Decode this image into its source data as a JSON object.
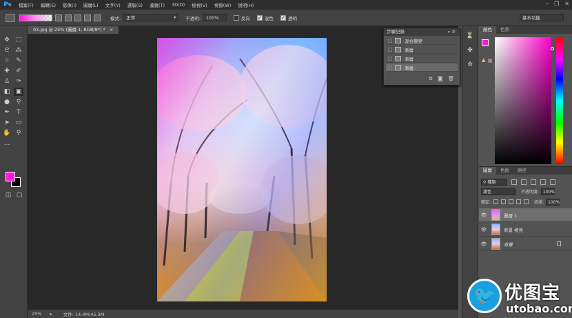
{
  "app": {
    "logo": "Ps"
  },
  "menu": [
    "檔案(F)",
    "編輯(E)",
    "影像(I)",
    "圖層(L)",
    "文字(Y)",
    "選取(S)",
    "濾鏡(T)",
    "3D(D)",
    "檢視(V)",
    "視窗(W)",
    "說明(H)"
  ],
  "window_controls": [
    "–",
    "❐",
    "✕"
  ],
  "options": {
    "mode_label": "模式:",
    "mode_value": "正常",
    "opacity_label": "不透明:",
    "opacity_value": "100%",
    "reverse_label": "反向",
    "reverse_checked": false,
    "dither_label": "混色",
    "dither_checked": true,
    "transparency_label": "透明",
    "transparency_checked": true,
    "workspace": "基本功能"
  },
  "document": {
    "tab_title": "02.jpg @ 25% (圖層 1, RGB/8*) *",
    "tab_close": "×"
  },
  "status": {
    "zoom": "25%",
    "file_info": "文件: 14.4M/45.3M"
  },
  "history": {
    "title": "步驟記錄",
    "items": [
      {
        "label": "混合變更",
        "selected": false
      },
      {
        "label": "漸層",
        "selected": false
      },
      {
        "label": "漸層",
        "selected": false
      },
      {
        "label": "漸層",
        "selected": true
      }
    ]
  },
  "color_panel": {
    "tabs": [
      "顏色",
      "色票"
    ],
    "foreground": "#ff1ad9",
    "hue_color": "#ff00cc"
  },
  "layers_panel": {
    "tabs": [
      "圖層",
      "色版",
      "路徑"
    ],
    "kind_label": "種類",
    "blend_mode": "濾色",
    "opacity_label": "不透明度:",
    "opacity_value": "100%",
    "lock_label": "鎖定:",
    "fill_label": "填滿:",
    "fill_value": "100%",
    "layers": [
      {
        "name": "圖層 1",
        "selected": true,
        "locked": false
      },
      {
        "name": "背景 拷貝",
        "selected": false,
        "locked": false
      },
      {
        "name": "背景",
        "selected": false,
        "locked": true
      }
    ]
  },
  "watermark": {
    "cn": "优图宝",
    "url": "utobao.com"
  }
}
